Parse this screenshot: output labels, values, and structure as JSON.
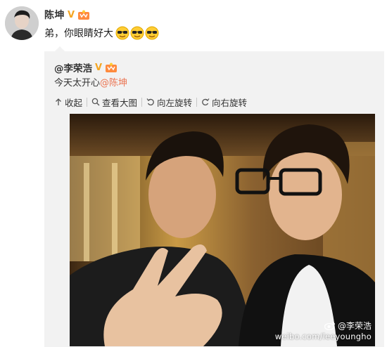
{
  "post": {
    "author": "陈坤",
    "verified_badge": "V",
    "text": "弟，你眼睛好大",
    "emojis": [
      "sunglasses-emoji",
      "sunglasses-emoji",
      "sunglasses-emoji"
    ]
  },
  "repost": {
    "author": "@李荣浩",
    "verified_badge": "V",
    "text_prefix": "今天太开心",
    "mention": "@陈坤",
    "toolbar": {
      "collapse": "收起",
      "view_large": "查看大图",
      "rotate_left": "向左旋转",
      "rotate_right": "向右旋转"
    },
    "photo": {
      "watermark_name": "@李荣浩",
      "watermark_url": "weibo.com/leeyoungho"
    }
  },
  "colors": {
    "mention": "#eb7350",
    "verified": "#f5a623",
    "repost_bg": "#f2f2f2"
  }
}
